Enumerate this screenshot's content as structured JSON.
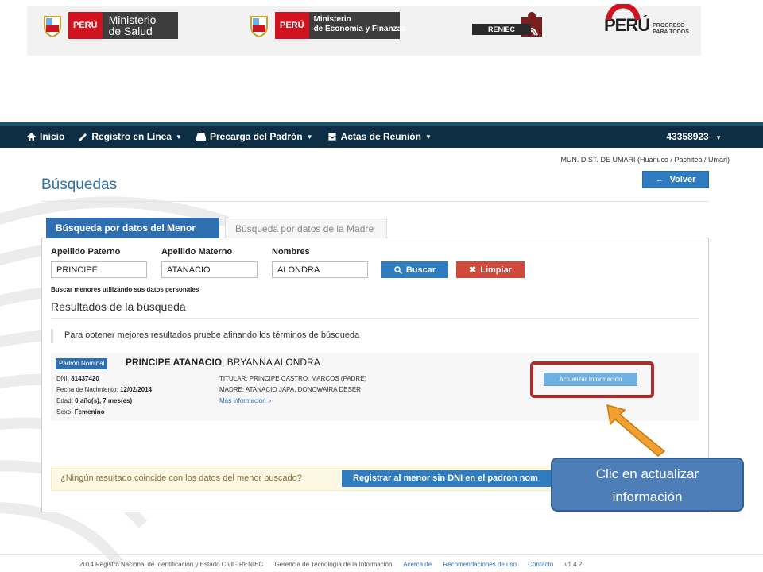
{
  "logos": {
    "minsa": {
      "peru": "PERÚ",
      "line1": "Ministerio",
      "line2": "de Salud"
    },
    "mef": {
      "peru": "PERÚ",
      "line1": "Ministerio",
      "line2": "de Economía y Finanzas"
    },
    "reniec": {
      "text": "RENIEC"
    },
    "peru_brand": {
      "text": "PERÚ",
      "tag1": "PROGRESO",
      "tag2": "PARA TODOS"
    }
  },
  "navbar": {
    "items": [
      {
        "label": "Inicio",
        "icon": "home-icon"
      },
      {
        "label": "Registro en Línea",
        "icon": "pencil-icon"
      },
      {
        "label": "Precarga del Padrón",
        "icon": "hdd-icon"
      },
      {
        "label": "Actas de Reunión",
        "icon": "inbox-icon"
      }
    ],
    "user": "43358923"
  },
  "municipality": "MUN. DIST. DE UMARI (Huanuco / Pachitea / Umari)",
  "page_title": "Búsquedas",
  "volver_label": "Volver",
  "tabs": [
    {
      "label": "Búsqueda por datos del Menor",
      "active": true
    },
    {
      "label": "Búsqueda por datos de la Madre",
      "active": false
    }
  ],
  "form": {
    "apellido_paterno": {
      "label": "Apellido Paterno",
      "value": "PRINCIPE"
    },
    "apellido_materno": {
      "label": "Apellido Materno",
      "value": "ATANACIO"
    },
    "nombres": {
      "label": "Nombres",
      "value": "ALONDRA"
    },
    "buscar_label": "Buscar",
    "limpiar_label": "Limpiar",
    "hint": "Buscar menores utilizando sus datos personales"
  },
  "results": {
    "title": "Resultados de la búsqueda",
    "tip": "Para obtener mejores resultados pruebe afinando los términos de búsqueda",
    "item": {
      "badge": "Padrón Nominal",
      "name_bold": "PRINCIPE ATANACIO",
      "name_rest": ", BRYANNA ALONDRA",
      "dni_label": "DNI: ",
      "dni": "81437420",
      "fecha_label": "Fecha de Nacimiento: ",
      "fecha": "12/02/2014",
      "edad_label": "Edad: ",
      "edad": "0 año(s), 7 mes(es)",
      "sexo_label": "Sexo: ",
      "sexo": "Femenino",
      "titular": "TITULAR: PRINCIPE CASTRO, MARCOS (PADRE)",
      "madre": "MADRE: ATANACIO JAPA, DONOWAIRA DESER",
      "more": "Más información »",
      "actualizar_label": "Actualizar Información"
    }
  },
  "no_result": {
    "text": "¿Ningún resultado coincide con los datos del menor buscado?",
    "button": "Registrar al menor sin DNI en el padron nom"
  },
  "callout": {
    "line1": "Clic en actualizar",
    "line2": "información"
  },
  "footer": {
    "copyright": "2014 Registro Nacional de Identificación y Estado Civil - RENIEC",
    "gerencia": "Gerencia de Tecnología de la Información",
    "acerca": "Acerca de",
    "recomendaciones": "Recomendaciones de uso",
    "contacto": "Contacto",
    "version": "v1.4.2"
  },
  "colors": {
    "navbar": "#0d2f45",
    "primary": "#2f7cc0",
    "danger": "#d04a3c",
    "callout": "#4d7eb8",
    "highlight": "#b22b2b",
    "arrow": "#f0a030"
  }
}
